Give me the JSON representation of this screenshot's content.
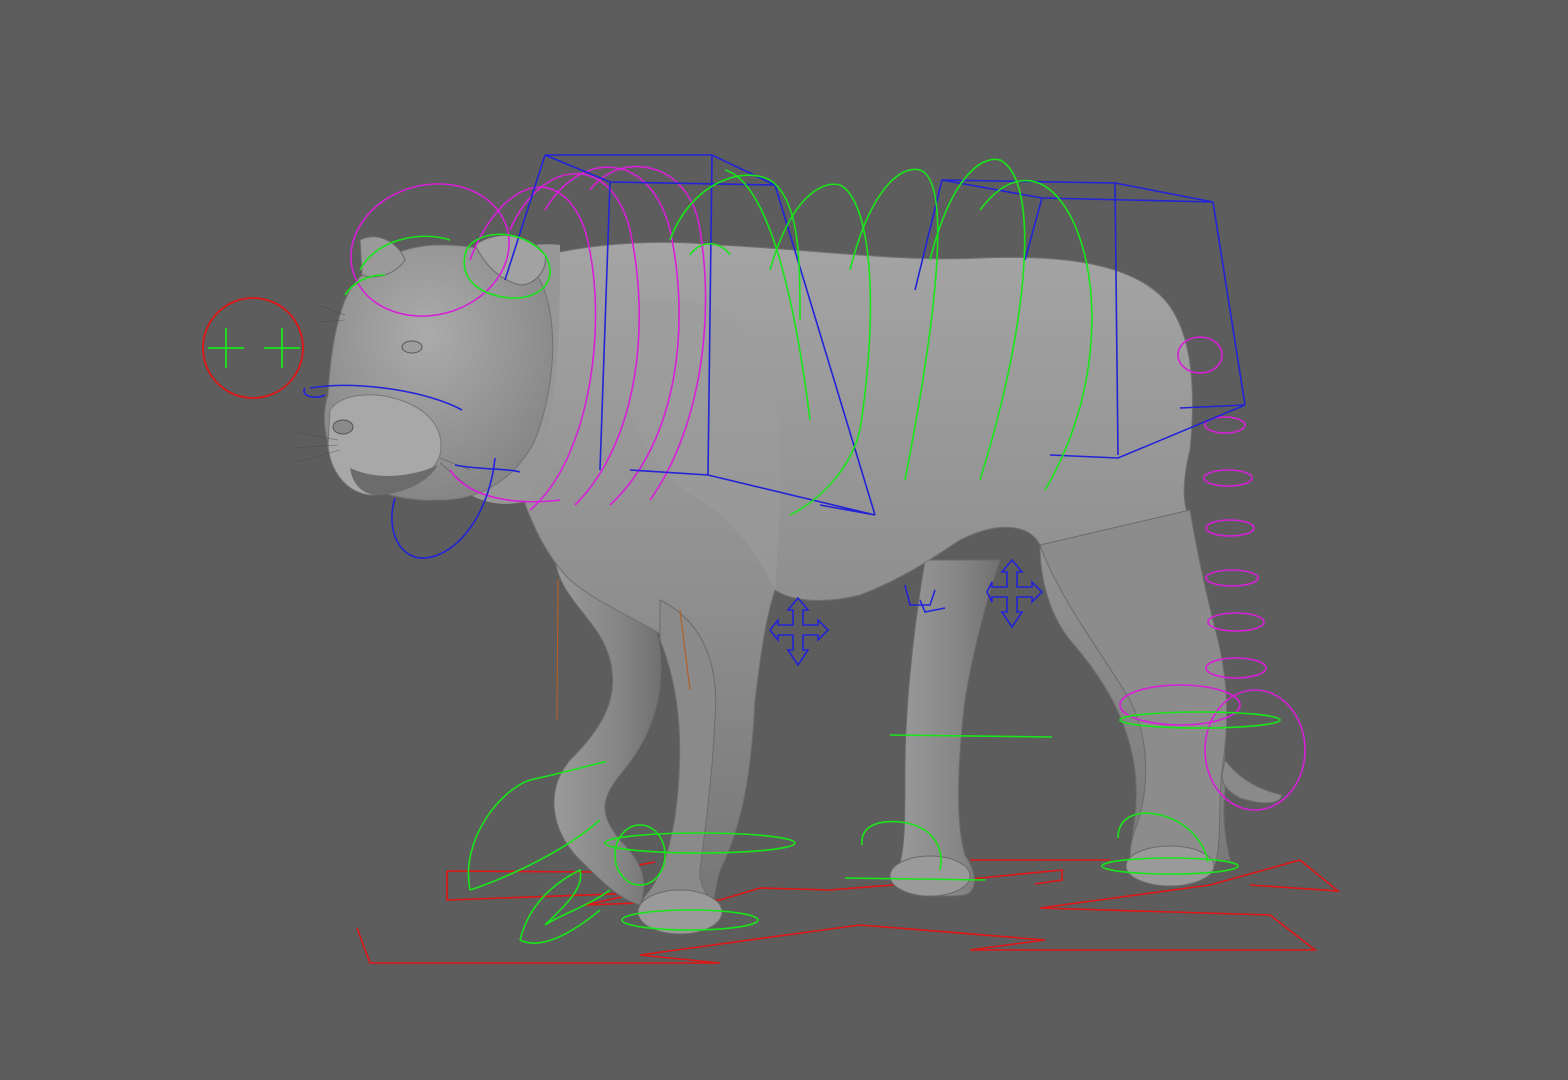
{
  "viewport": {
    "background": "#5d5d5d"
  },
  "model": {
    "subject": "big-cat",
    "body_color": "#8f8f8f",
    "shade_color": "#6e6e6e",
    "highlight_color": "#a9a9a9"
  },
  "controls": {
    "colors": {
      "ik_green": "#19e619",
      "fk_magenta": "#d81fd8",
      "box_blue": "#2323d8",
      "ground_red": "#e01616"
    },
    "items": [
      {
        "name": "eye-aim-control",
        "color": "ground_red",
        "icon": "crosshair-icon"
      },
      {
        "name": "head-control",
        "color": "fk_magenta"
      },
      {
        "name": "jaw-control",
        "color": "box_blue"
      },
      {
        "name": "neck-controls",
        "color": "fk_magenta"
      },
      {
        "name": "chest-box-control",
        "color": "box_blue"
      },
      {
        "name": "hip-box-control",
        "color": "box_blue"
      },
      {
        "name": "spine-controls",
        "color": "ik_green"
      },
      {
        "name": "tail-controls",
        "color": "fk_magenta"
      },
      {
        "name": "pole-vector-controls",
        "color": "box_blue",
        "icon": "move-arrows-icon"
      },
      {
        "name": "foot-ik-controls",
        "color": "ik_green"
      },
      {
        "name": "ground-controls",
        "color": "ground_red"
      }
    ]
  }
}
